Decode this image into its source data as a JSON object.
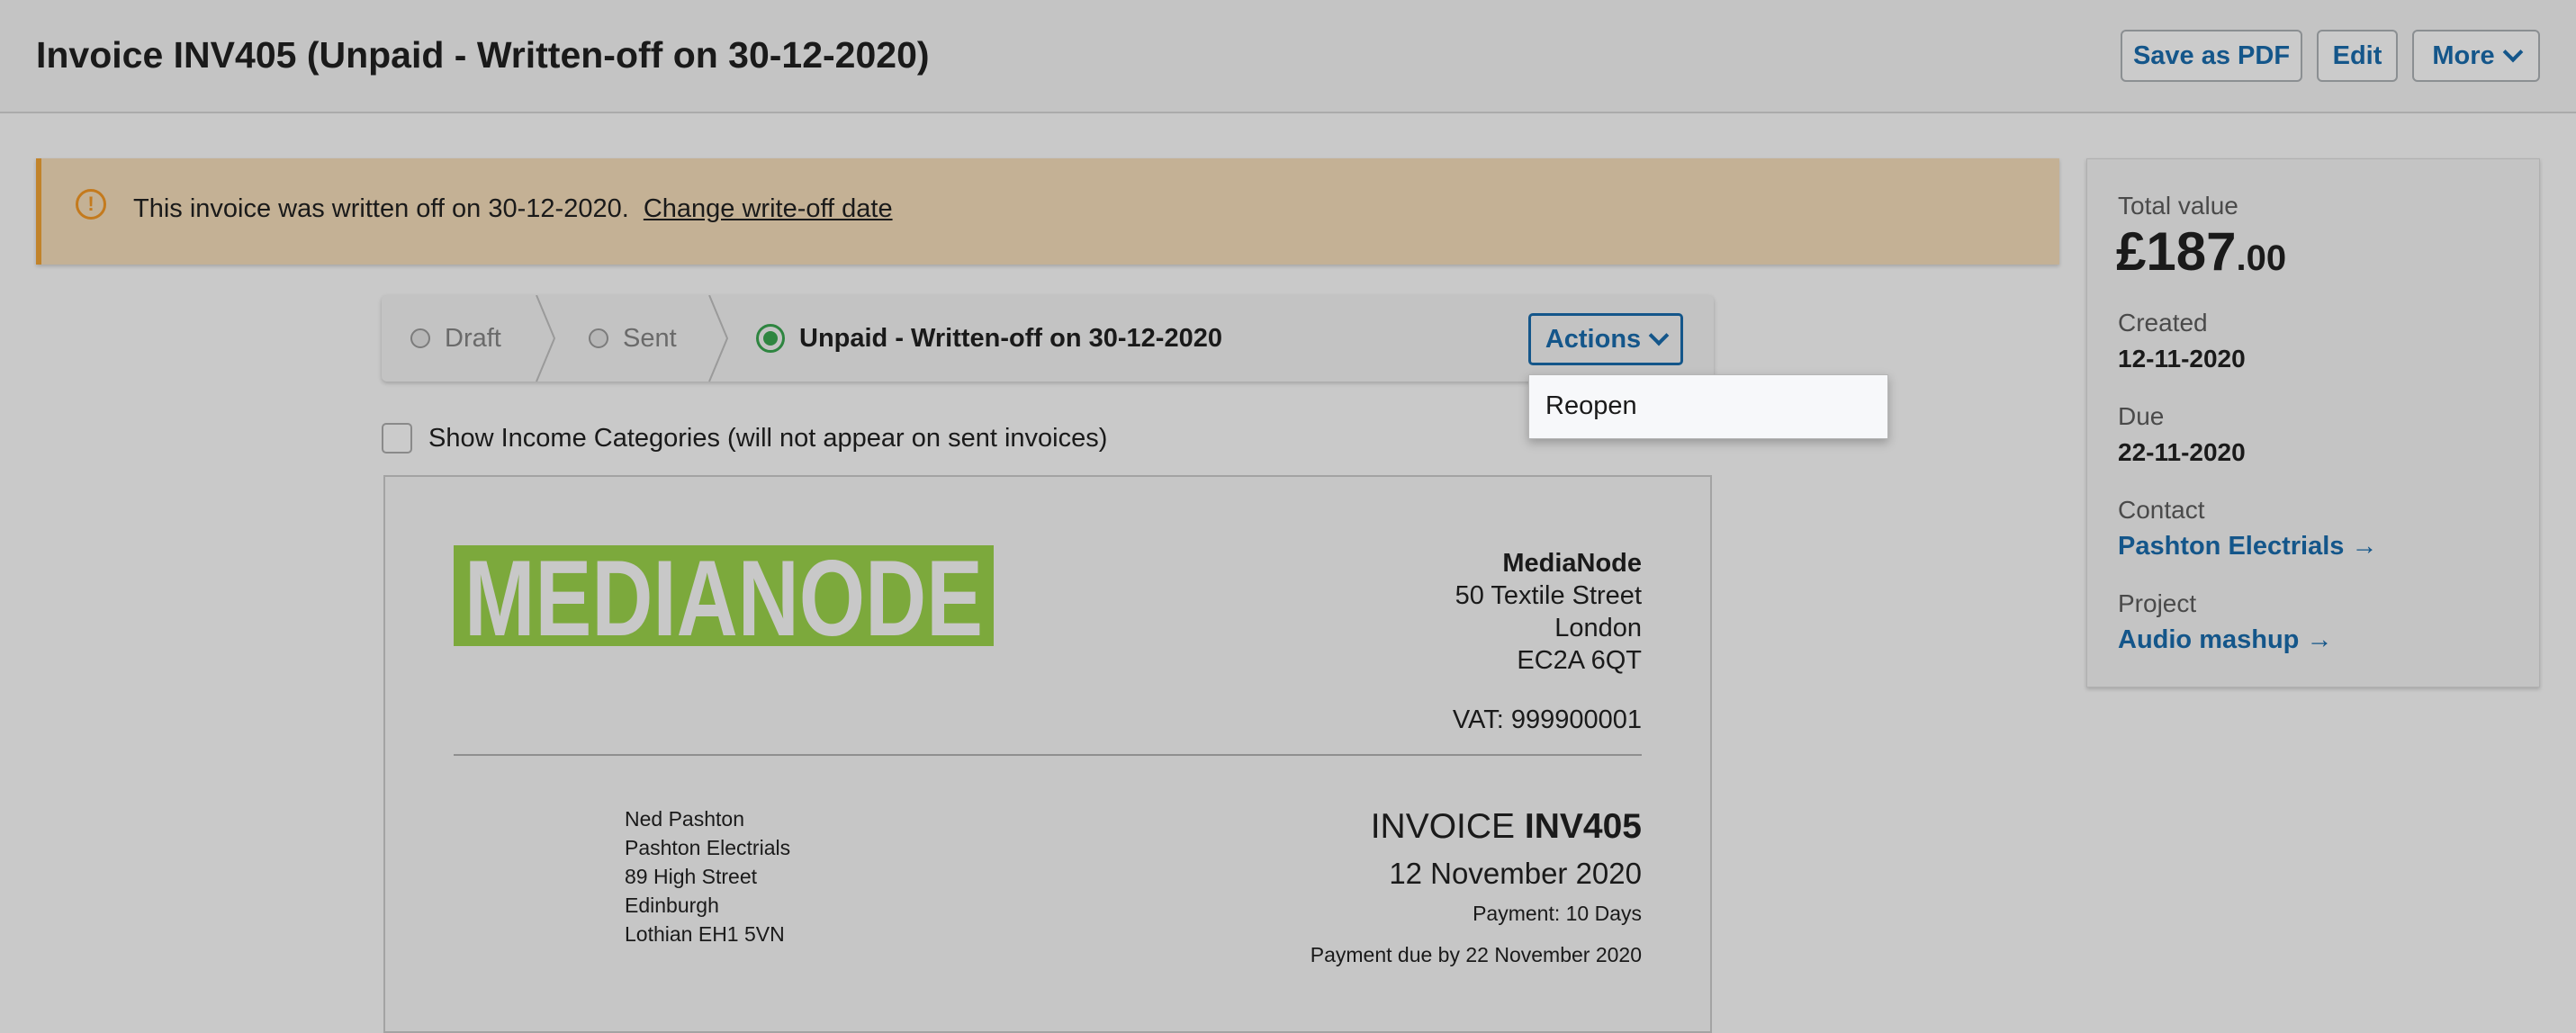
{
  "header": {
    "title": "Invoice INV405 (Unpaid - Written-off on 30-12-2020)",
    "buttons": {
      "save_pdf": "Save as PDF",
      "edit": "Edit",
      "more": "More"
    }
  },
  "banner": {
    "icon": "warning-icon",
    "message": "This invoice was written off on 30-12-2020.",
    "link": "Change write-off date"
  },
  "status": {
    "steps": [
      {
        "label": "Draft",
        "state": "inactive"
      },
      {
        "label": "Sent",
        "state": "inactive"
      },
      {
        "label": "Unpaid - Written-off on 30-12-2020",
        "state": "active"
      }
    ],
    "actions_label": "Actions",
    "dropdown_items": [
      "Reopen"
    ]
  },
  "options": {
    "show_income_categories": {
      "label": "Show Income Categories (will not appear on sent invoices)",
      "checked": false
    }
  },
  "invoice": {
    "logo_text": "MEDIANODE",
    "company": {
      "name": "MediaNode",
      "address": [
        "50 Textile Street",
        "London",
        "EC2A 6QT"
      ],
      "vat": "VAT: 999900001"
    },
    "client": {
      "lines": [
        "Ned Pashton",
        "Pashton Electrials",
        "89 High Street",
        "Edinburgh",
        "Lothian EH1 5VN"
      ]
    },
    "title_prefix": "INVOICE",
    "number": "INV405",
    "date": "12 November 2020",
    "payment_terms": "Payment: 10 Days",
    "payment_due": "Payment due by 22 November 2020"
  },
  "summary": {
    "total_label": "Total value",
    "total_major": "£187",
    "total_minor": ".00",
    "created_label": "Created",
    "created_value": "12-11-2020",
    "due_label": "Due",
    "due_value": "22-11-2020",
    "contact_label": "Contact",
    "contact_value": "Pashton Electrials →",
    "project_label": "Project",
    "project_value": "Audio mashup →"
  },
  "colors": {
    "link": "#14568a",
    "warning_accent": "#c1832a",
    "banner_bg": "#c4b195",
    "active_status": "#2e8540",
    "logo_bg": "#7ca93c"
  }
}
